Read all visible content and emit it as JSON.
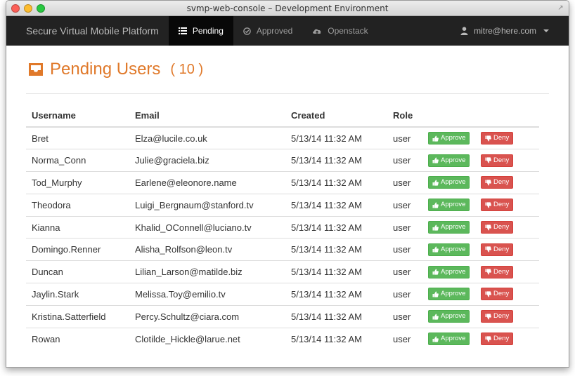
{
  "window": {
    "title": "svmp-web-console – Development Environment"
  },
  "navbar": {
    "brand": "Secure Virtual Mobile Platform",
    "items": [
      {
        "label": "Pending",
        "icon": "list-icon",
        "active": true
      },
      {
        "label": "Approved",
        "icon": "check-circle-icon",
        "active": false
      },
      {
        "label": "Openstack",
        "icon": "cloud-upload-icon",
        "active": false
      }
    ],
    "user": {
      "label": "mitre@here.com",
      "icon": "user-icon"
    }
  },
  "page": {
    "title": "Pending Users",
    "count": "( 10 )",
    "icon": "inbox-icon"
  },
  "table": {
    "headers": [
      "Username",
      "Email",
      "Created",
      "Role"
    ],
    "approve_label": "Approve",
    "deny_label": "Deny",
    "rows": [
      {
        "username": "Bret",
        "email": "Elza@lucile.co.uk",
        "created": "5/13/14 11:32 AM",
        "role": "user"
      },
      {
        "username": "Norma_Conn",
        "email": "Julie@graciela.biz",
        "created": "5/13/14 11:32 AM",
        "role": "user"
      },
      {
        "username": "Tod_Murphy",
        "email": "Earlene@eleonore.name",
        "created": "5/13/14 11:32 AM",
        "role": "user"
      },
      {
        "username": "Theodora",
        "email": "Luigi_Bergnaum@stanford.tv",
        "created": "5/13/14 11:32 AM",
        "role": "user"
      },
      {
        "username": "Kianna",
        "email": "Khalid_OConnell@luciano.tv",
        "created": "5/13/14 11:32 AM",
        "role": "user"
      },
      {
        "username": "Domingo.Renner",
        "email": "Alisha_Rolfson@leon.tv",
        "created": "5/13/14 11:32 AM",
        "role": "user"
      },
      {
        "username": "Duncan",
        "email": "Lilian_Larson@matilde.biz",
        "created": "5/13/14 11:32 AM",
        "role": "user"
      },
      {
        "username": "Jaylin.Stark",
        "email": "Melissa.Toy@emilio.tv",
        "created": "5/13/14 11:32 AM",
        "role": "user"
      },
      {
        "username": "Kristina.Satterfield",
        "email": "Percy.Schultz@ciara.com",
        "created": "5/13/14 11:32 AM",
        "role": "user"
      },
      {
        "username": "Rowan",
        "email": "Clotilde_Hickle@larue.net",
        "created": "5/13/14 11:32 AM",
        "role": "user"
      }
    ]
  },
  "colors": {
    "accent": "#e0792a",
    "navbar": "#222222",
    "approve": "#5cb85c",
    "deny": "#d9534f"
  }
}
